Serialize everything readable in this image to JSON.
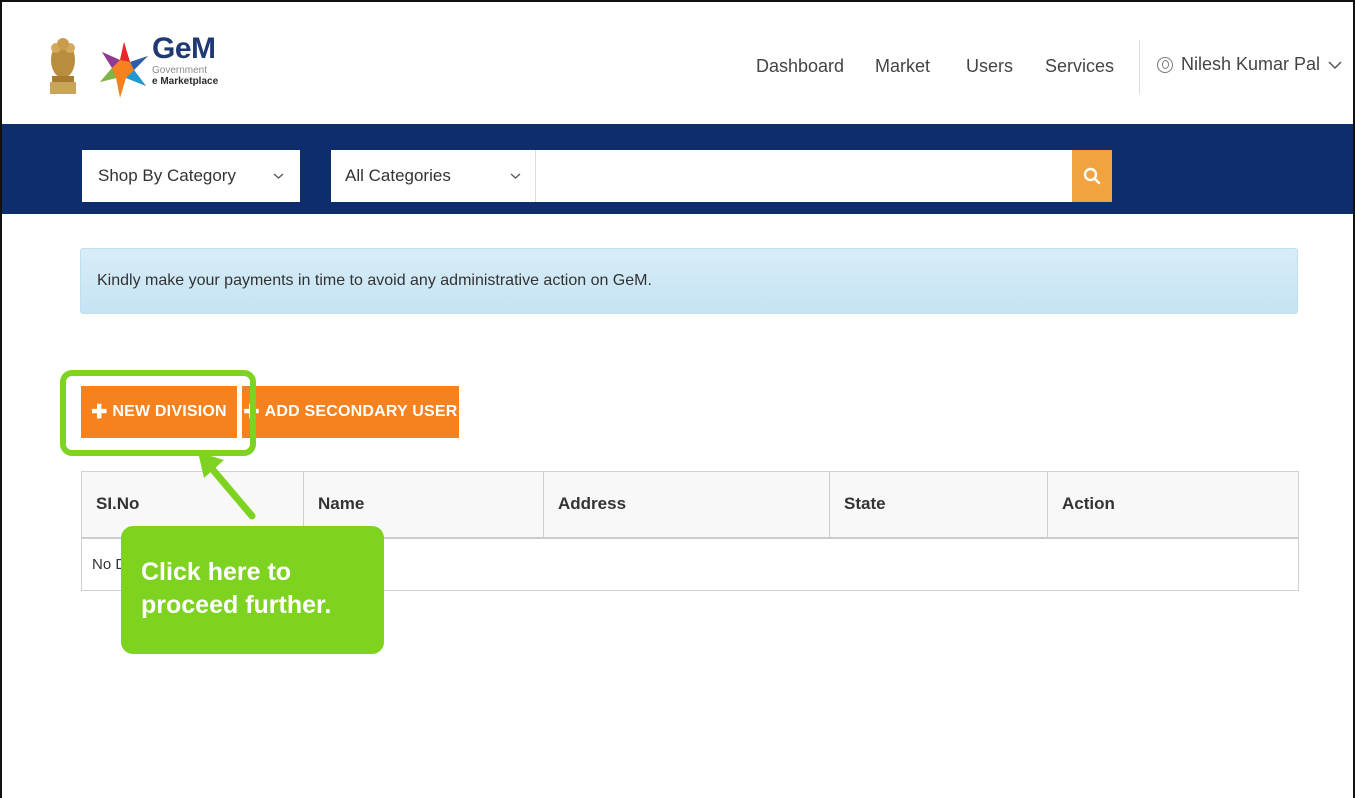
{
  "header": {
    "logo": {
      "title": "GeM",
      "sub1": "Government",
      "sub2": "e Marketplace"
    },
    "nav": {
      "dashboard": "Dashboard",
      "market": "Market",
      "users": "Users",
      "services": "Services"
    },
    "user_name": "Nilesh Kumar Pal"
  },
  "search": {
    "shop_by": "Shop By Category",
    "category": "All Categories",
    "placeholder": ""
  },
  "alert": {
    "text": "Kindly make your payments in time to avoid any administrative action on GeM."
  },
  "actions": {
    "new_division": "NEW DIVISION",
    "add_secondary_user": "ADD SECONDARY USER"
  },
  "table": {
    "headers": [
      "SI.No",
      "Name",
      "Address",
      "State",
      "Action"
    ],
    "empty_text": "No D"
  },
  "callout": {
    "line1": "Click here to",
    "line2": "proceed further."
  },
  "colors": {
    "brand_navy": "#0d2d6c",
    "accent_orange": "#f5821f",
    "search_button": "#f0a33e",
    "callout_green": "#7ed321"
  }
}
